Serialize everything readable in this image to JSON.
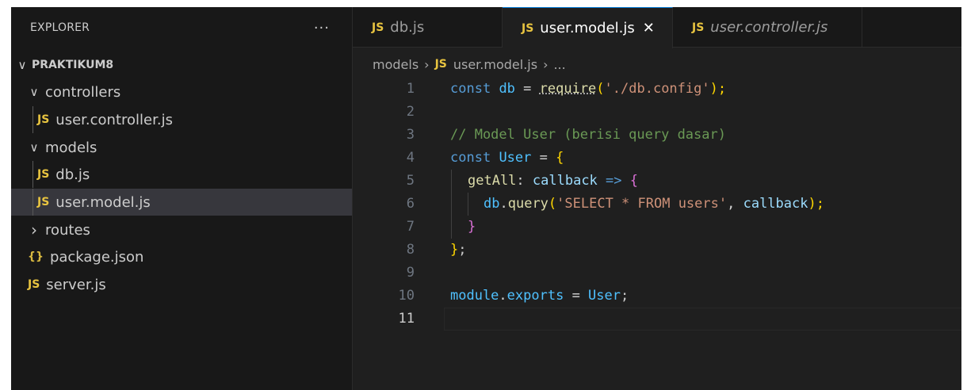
{
  "sidebar": {
    "title": "EXPLORER",
    "more": "···",
    "items": [
      {
        "label": "PRAKTIKUM8",
        "chevron": "∨"
      },
      {
        "label": "controllers",
        "chevron": "∨"
      },
      {
        "label": "user.controller.js",
        "badge": "JS"
      },
      {
        "label": "models",
        "chevron": "∨"
      },
      {
        "label": "db.js",
        "badge": "JS"
      },
      {
        "label": "user.model.js",
        "badge": "JS"
      },
      {
        "label": "routes",
        "chevron": "›"
      },
      {
        "label": "package.json",
        "badge": "{}"
      },
      {
        "label": "server.js",
        "badge": "JS"
      }
    ]
  },
  "tabs": [
    {
      "badge": "JS",
      "label": "db.js"
    },
    {
      "badge": "JS",
      "label": "user.model.js",
      "close": "✕"
    },
    {
      "badge": "JS",
      "label": "user.controller.js"
    }
  ],
  "breadcrumb": {
    "folder": "models",
    "sep1": "›",
    "badge": "JS",
    "file": "user.model.js",
    "sep2": "›",
    "more": "..."
  },
  "code": {
    "line_numbers": [
      "1",
      "2",
      "3",
      "4",
      "5",
      "6",
      "7",
      "8",
      "9",
      "10",
      "11"
    ],
    "l1": {
      "kw": "const",
      "var": "db",
      "op": " = ",
      "fn": "require",
      "p1": "(",
      "str": "'./db.config'",
      "p2": ");"
    },
    "l3": {
      "comment": "// Model User (berisi query dasar)"
    },
    "l4": {
      "kw": "const",
      "var": "User",
      "op": " = ",
      "brace": "{"
    },
    "l5": {
      "fn": "getAll",
      "colon": ": ",
      "param": "callback",
      "arrow": " => ",
      "brace": "{"
    },
    "l6": {
      "obj": "db",
      "dot": ".",
      "fn": "query",
      "p1": "(",
      "str": "'SELECT * FROM users'",
      "comma": ", ",
      "param": "callback",
      "p2": ");"
    },
    "l7": {
      "brace": "}"
    },
    "l8": {
      "brace": "}",
      "semi": ";"
    },
    "l10": {
      "obj": "module",
      "dot": ".",
      "prop": "exports",
      "op": " = ",
      "var": "User",
      "semi": ";"
    }
  },
  "colors": {
    "accent": "#0078d4",
    "js_badge": "#e8c440",
    "selected_row": "#37373d"
  }
}
